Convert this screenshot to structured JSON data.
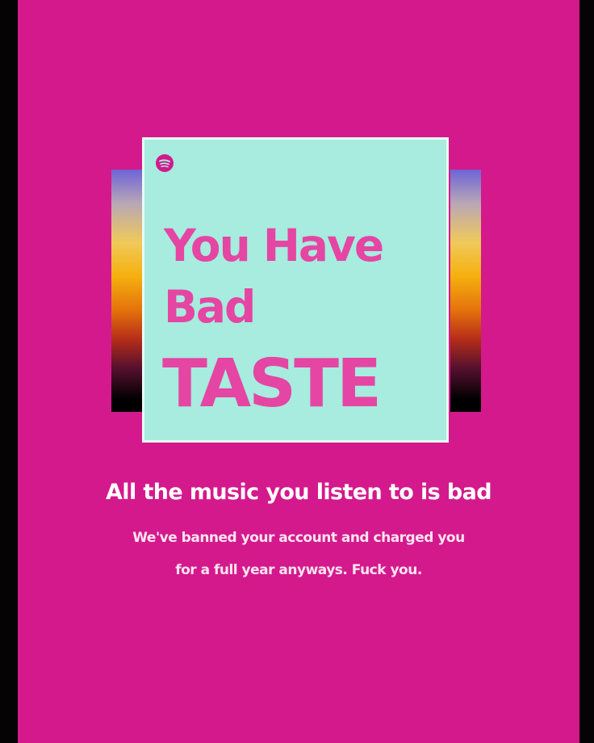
{
  "colors": {
    "background": "#d4198c",
    "card": "#a7ecdf",
    "headline": "#e545a3",
    "text": "#ffffff"
  },
  "card": {
    "logo_icon": "spotify-icon",
    "headline_line1": "You Have",
    "headline_line2": "Bad",
    "headline_line3": "TASTE"
  },
  "message": {
    "title": "All the music you listen to is bad",
    "body_line1": "We've banned your account and charged you",
    "body_line2": "for a full year anyways. Fuck you."
  }
}
